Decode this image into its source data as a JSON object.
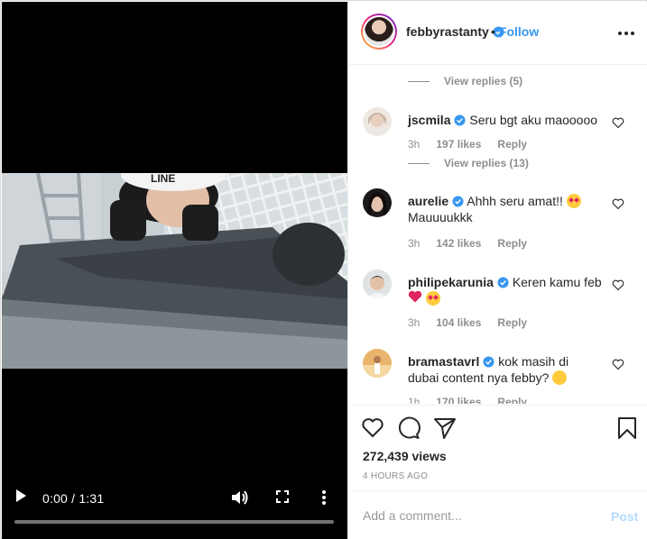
{
  "post": {
    "username": "febbyrastanty",
    "follow_separator": "•",
    "follow_label": "Follow",
    "views_label": "272,439 views",
    "time_ago": "4 HOURS AGO"
  },
  "video": {
    "time_display": "0:00 / 1:31",
    "progress": 0,
    "helmet_text": "LINE"
  },
  "comments": {
    "view_replies_top": "View replies (5)",
    "items": [
      {
        "user": "jscmila",
        "text": "Seru bgt aku maooooo",
        "time": "3h",
        "likes": "197 likes",
        "reply": "Reply",
        "view_replies": "View replies (13)"
      },
      {
        "user": "aurelie",
        "text": "Ahhh seru amat!!",
        "text2": "Mauuuukkk",
        "time": "3h",
        "likes": "142 likes",
        "reply": "Reply"
      },
      {
        "user": "philipekarunia",
        "text": "Keren kamu feb",
        "time": "3h",
        "likes": "104 likes",
        "reply": "Reply"
      },
      {
        "user": "bramastavrl",
        "text": "kok masih di",
        "text2": "dubai content nya febby?",
        "time": "1h",
        "likes": "170 likes",
        "reply": "Reply"
      }
    ]
  },
  "add_comment": {
    "placeholder": "Add a comment...",
    "post_label": "Post"
  },
  "colors": {
    "accent": "#3897f0",
    "post_disabled": "#b3dbff",
    "muted": "#8e8e8e",
    "text": "#262626"
  }
}
